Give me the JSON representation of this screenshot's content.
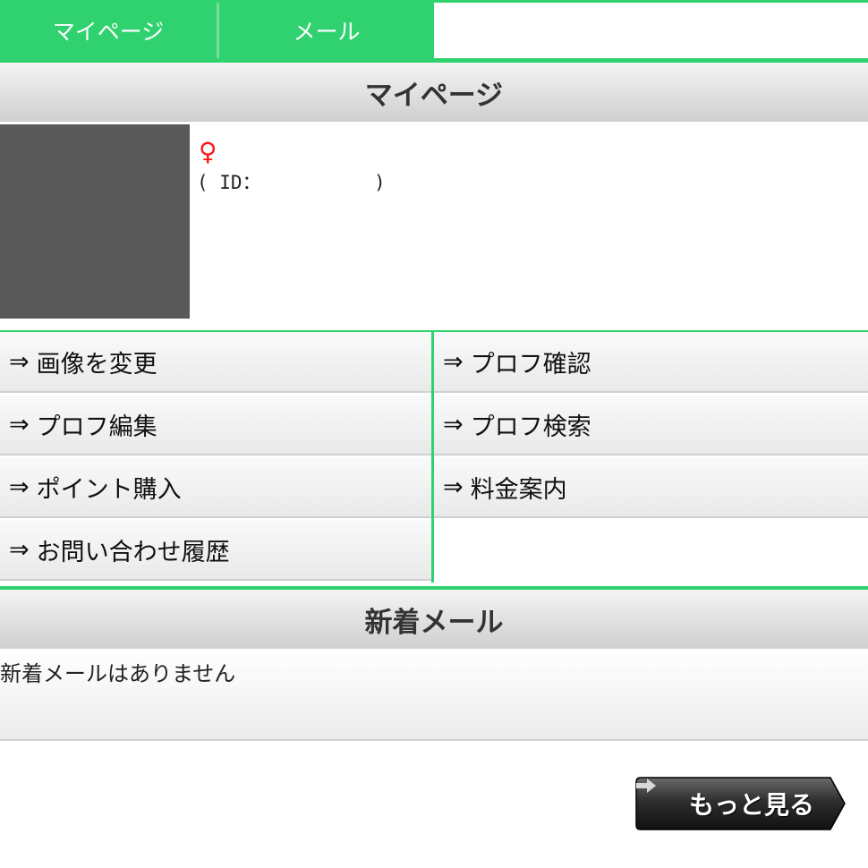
{
  "tabs": [
    {
      "label": "マイページ"
    },
    {
      "label": "メール"
    }
  ],
  "mypage": {
    "title": "マイページ",
    "gender_symbol": "♀",
    "id_text": "( ID：          )"
  },
  "menu": {
    "arrow": "⇒",
    "items": [
      {
        "label": "画像を変更"
      },
      {
        "label": "プロフ確認"
      },
      {
        "label": "プロフ編集"
      },
      {
        "label": "プロフ検索"
      },
      {
        "label": "ポイント購入"
      },
      {
        "label": "料金案内"
      },
      {
        "label": "お問い合わせ履歴"
      }
    ]
  },
  "new_mail": {
    "title": "新着メール",
    "empty_message": "新着メールはありません",
    "more_label": "もっと見る"
  },
  "colors": {
    "accent": "#2fd26f",
    "gender": "#ff1a1a",
    "avatar_placeholder": "#595959"
  }
}
